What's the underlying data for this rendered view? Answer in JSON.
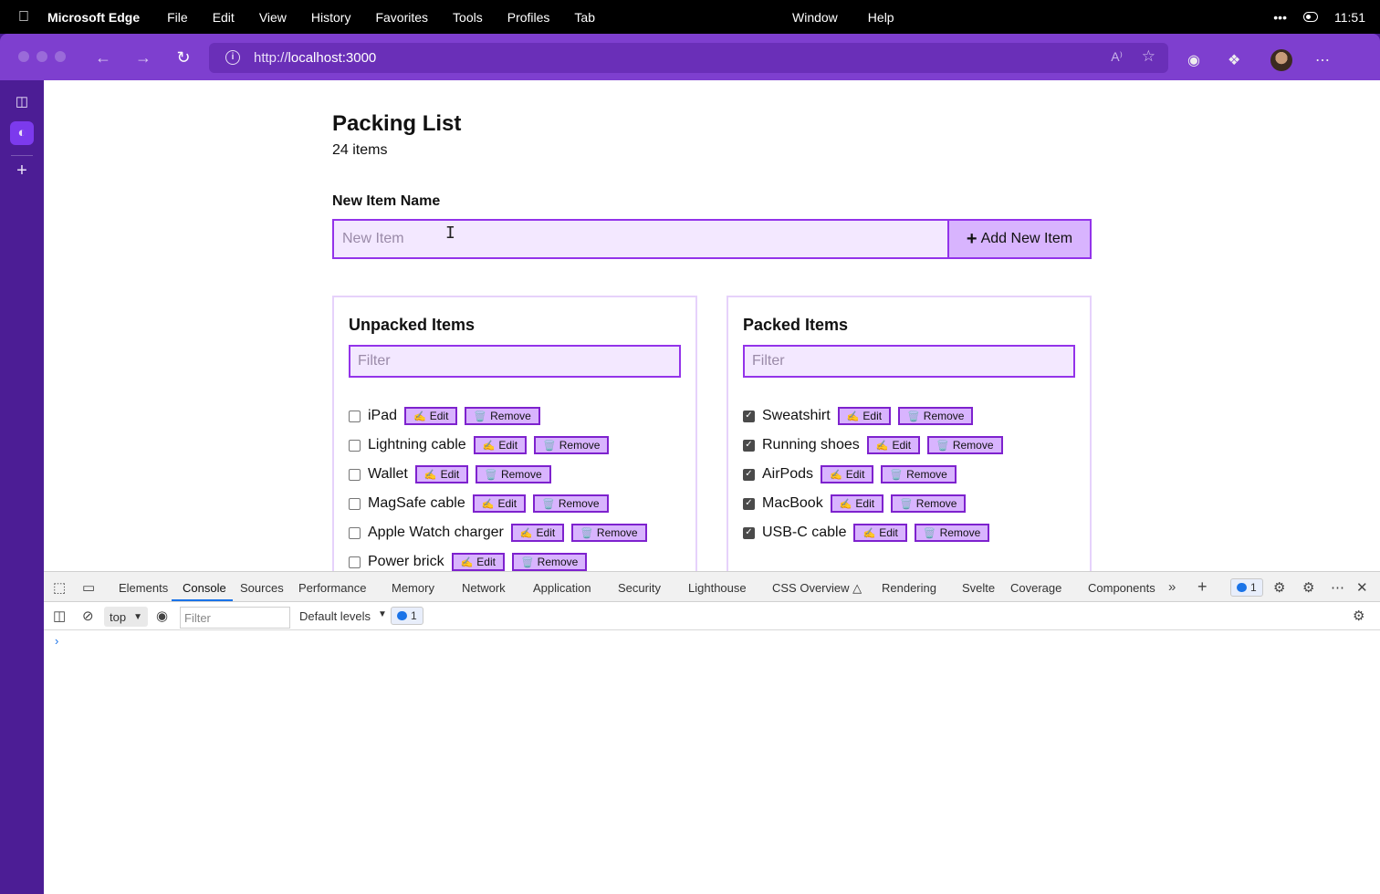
{
  "menubar": {
    "app_name": "Microsoft Edge",
    "menus": [
      "File",
      "Edit",
      "View",
      "History",
      "Favorites",
      "Tools",
      "Profiles",
      "Tab"
    ],
    "right_menus": [
      "Window",
      "Help"
    ],
    "time": "11:51"
  },
  "browser": {
    "url_prefix": "http://",
    "url_host": "localhost:3000",
    "readaloud": "A⁾"
  },
  "page": {
    "title": "Packing List",
    "count": "24 items",
    "new_item_label": "New Item Name",
    "new_item_placeholder": "New Item",
    "add_button_label": "Add New Item",
    "unpacked": {
      "heading": "Unpacked Items",
      "filter_placeholder": "Filter",
      "items": [
        {
          "name": "iPad",
          "checked": false
        },
        {
          "name": "Lightning cable",
          "checked": false
        },
        {
          "name": "Wallet",
          "checked": false
        },
        {
          "name": "MagSafe cable",
          "checked": false
        },
        {
          "name": "Apple Watch charger",
          "checked": false
        },
        {
          "name": "Power brick",
          "checked": false
        }
      ]
    },
    "packed": {
      "heading": "Packed Items",
      "filter_placeholder": "Filter",
      "items": [
        {
          "name": "Sweatshirt",
          "checked": true
        },
        {
          "name": "Running shoes",
          "checked": true
        },
        {
          "name": "AirPods",
          "checked": true
        },
        {
          "name": "MacBook",
          "checked": true
        },
        {
          "name": "USB-C cable",
          "checked": true
        }
      ]
    },
    "edit_label": "Edit",
    "remove_label": "Remove"
  },
  "devtools": {
    "tabs": [
      "Elements",
      "Console",
      "Sources",
      "Performance",
      "Memory",
      "Network",
      "Application",
      "Security",
      "Lighthouse",
      "CSS Overview",
      "Rendering",
      "Svelte",
      "Coverage",
      "Components"
    ],
    "active_tab": "Console",
    "issues_count": "1",
    "context": "top",
    "filter_placeholder": "Filter",
    "levels": "Default levels",
    "message_count": "1"
  },
  "colors": {
    "accent": "#9333ea",
    "input_bg": "#f3e8ff",
    "button_bg": "#d8b4fe",
    "chrome": "#7e3fcf",
    "sidebar": "#4c1d95"
  },
  "icons": {
    "edit": "✍️",
    "remove": "🗑️",
    "checkmark": "✓"
  }
}
